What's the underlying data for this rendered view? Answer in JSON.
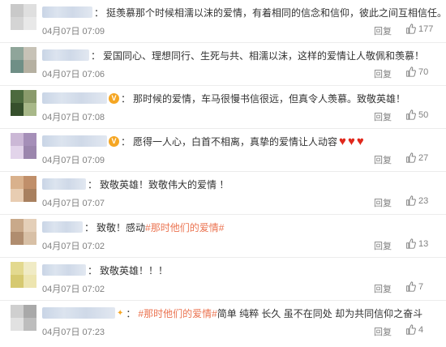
{
  "actions": {
    "reply_label": "回复"
  },
  "colors": {
    "topic": "#eb7350",
    "heart": "#e0281c",
    "vip_badge": "#f5a623",
    "meta": "#808080"
  },
  "comments": [
    {
      "name_width": 62,
      "badge": false,
      "text": "挺羡慕那个时候相濡以沫的爱情，有着相同的信念和信仰，彼此之间互相信任。",
      "time": "04月07日 07:09",
      "likes": "177",
      "avatar": [
        "#c9c9c9",
        "#dfdfdf",
        "#d4d4d4",
        "#e8e8e8"
      ]
    },
    {
      "name_width": 58,
      "badge": false,
      "text": "爱国同心、理想同行、生死与共、相濡以沫，这样的爱情让人敬佩和羡慕！",
      "time": "04月07日 07:06",
      "likes": "70",
      "avatar": [
        "#8fa59a",
        "#c7c2b6",
        "#6f8f86",
        "#b5b0a1"
      ]
    },
    {
      "name_width": 80,
      "badge": true,
      "text": "那时候的爱情，车马很慢书信很远，但真令人羡慕。致敬英雄！",
      "time": "04月07日 07:08",
      "likes": "50",
      "avatar": [
        "#4c6a3e",
        "#8a9a6b",
        "#36502c",
        "#a8b889"
      ]
    },
    {
      "name_width": 80,
      "badge": true,
      "text": "愿得一人心，白首不相离，真挚的爱情让人动容",
      "hearts": true,
      "time": "04月07日 07:09",
      "likes": "27",
      "avatar": [
        "#cbb8d6",
        "#a58fb8",
        "#e2d4ea",
        "#9b86ad"
      ]
    },
    {
      "name_width": 54,
      "badge": false,
      "text": "致敬英雄！致敬伟大的爱情 ！",
      "time": "04月07日 07:07",
      "likes": "23",
      "avatar": [
        "#d9b18c",
        "#c08f6a",
        "#e8cdb2",
        "#a8805f"
      ]
    },
    {
      "name_width": 50,
      "badge": false,
      "text": "致敬！感动",
      "topic": "#那时他们的爱情#",
      "time": "04月07日 07:02",
      "likes": "13",
      "avatar": [
        "#c9a98a",
        "#e4cfb8",
        "#b08d6f",
        "#d8c0a6"
      ]
    },
    {
      "name_width": 54,
      "badge": false,
      "text": "致敬英雄！！！",
      "time": "04月07日 07:02",
      "likes": "7",
      "avatar": [
        "#e3d98f",
        "#f0ebc5",
        "#d6c970",
        "#ede5b0"
      ]
    },
    {
      "name_width": 90,
      "badge": false,
      "pre_icon": true,
      "topic": "#那时他们的爱情#",
      "text_after": " 简单 纯粹 长久 虽不在同处 却为共同信仰之奋斗",
      "time": "04月07日 07:23",
      "likes": "4",
      "avatar": [
        "#cfcfcf",
        "#a9a9a9",
        "#e1e1e1",
        "#bdbdbd"
      ]
    }
  ]
}
